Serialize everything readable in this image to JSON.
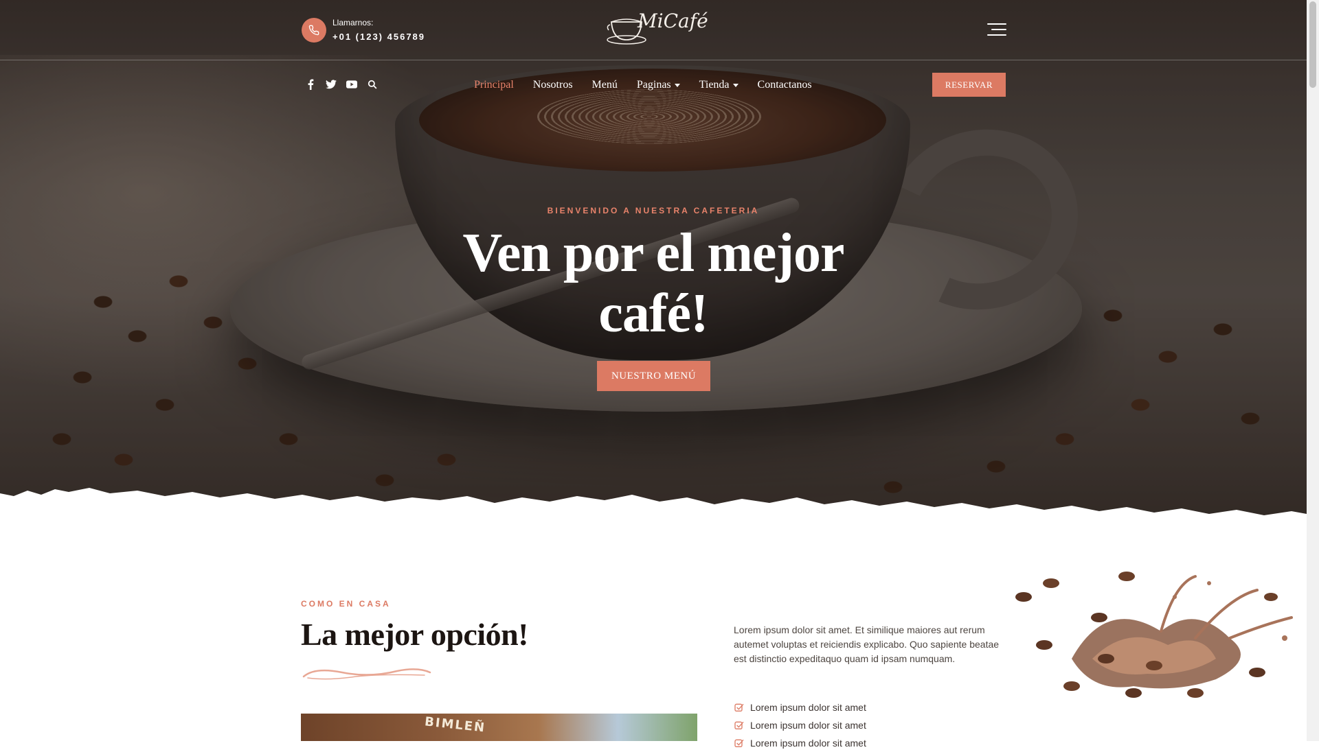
{
  "colors": {
    "accent": "#dc7a63",
    "accent_text": "#e8836b",
    "dark_text": "#1c1512",
    "white": "#ffffff"
  },
  "header": {
    "phone_icon": "phone-icon",
    "phone_label": "Llamarnos:",
    "phone_number": "+01 (123) 456789",
    "logo_text": "MiCafé",
    "menu_icon": "hamburger-menu-icon"
  },
  "social": [
    {
      "icon": "facebook-icon"
    },
    {
      "icon": "twitter-icon"
    },
    {
      "icon": "youtube-icon"
    },
    {
      "icon": "search-icon"
    }
  ],
  "nav": {
    "items": [
      {
        "label": "Principal",
        "active": true
      },
      {
        "label": "Nosotros"
      },
      {
        "label": "Menú"
      },
      {
        "label": "Paginas",
        "dropdown": true
      },
      {
        "label": "Tienda",
        "dropdown": true
      },
      {
        "label": "Contactanos"
      }
    ],
    "cta": "RESERVAR"
  },
  "hero": {
    "kicker": "BIENVENIDO A NUESTRA CAFETERIA",
    "title_line1": "Ven por el mejor",
    "title_line2": "café!",
    "button": "NUESTRO MENÚ"
  },
  "about": {
    "kicker": "COMO EN CASA",
    "title": "La mejor opción!",
    "image_sign": "BIMLEÑ",
    "paragraph": "Lorem ipsum dolor sit amet. Et similique maiores aut rerum autemet voluptas et reiciendis explicabo. Quo sapiente beatae est distinctio expeditaquo quam id ipsam numquam.",
    "checklist": [
      "Lorem ipsum dolor sit amet",
      "Lorem ipsum dolor sit amet",
      "Lorem ipsum dolor sit amet"
    ],
    "check_icon": "check-icon"
  }
}
